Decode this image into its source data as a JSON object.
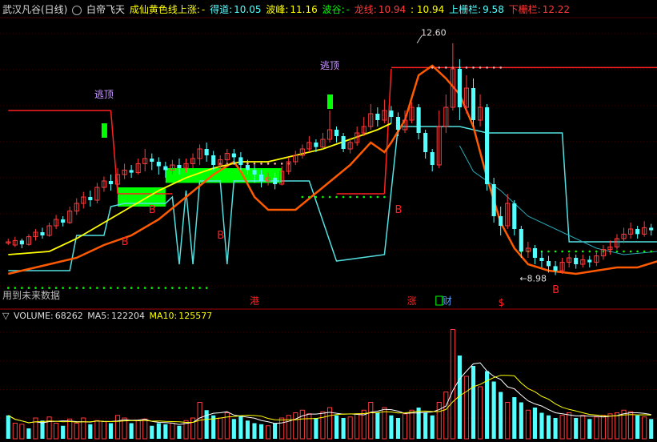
{
  "header": {
    "stock": "武汉凡谷(日线)",
    "indicator": "白帝飞天",
    "signal_label": "成仙黄色线上涨:",
    "signal_value": "-",
    "dezhi_label": "得道:",
    "dezhi_value": "10.05",
    "bofeng_label": "波峰:",
    "bofeng_value": "11.16",
    "bogu_label": "波谷:",
    "bogu_value": "-",
    "longxian_label": "龙线:",
    "longxian_value": "10.94",
    "sep_value": ": 10.94",
    "upper_label": "上栅栏:",
    "upper_value": "9.58",
    "lower_label": "下栅栏:",
    "lower_value": "12.22"
  },
  "note": "用到未来数据",
  "annotations": {
    "high_price": "12.60",
    "low_price": "8.98",
    "escape_top": "逃顶",
    "buy": "B",
    "events": [
      "港",
      "涨",
      "财",
      "$"
    ]
  },
  "volume_header": {
    "icon": "▽",
    "volume_label": "VOLUME:",
    "volume_value": "68262",
    "ma5_label": "MA5:",
    "ma5_value": "122204",
    "ma10_label": "MA10:",
    "ma10_value": "125577"
  },
  "colors": {
    "up": "#ff3b3b",
    "down": "#54ffff",
    "yellow": "#ffff00",
    "orange": "#ff5a00",
    "green": "#00ff00",
    "cyan_line": "#54e0e0",
    "red_line": "#ff2020",
    "purple": "#c89bff"
  },
  "chart_data": {
    "type": "candlestick",
    "price_range": [
      8.5,
      13.0
    ],
    "volume_max": 220000,
    "dezhi_resistance": 12.22,
    "candles": [
      [
        9.48,
        9.5,
        9.45,
        9.55,
        "up"
      ],
      [
        9.45,
        9.52,
        9.42,
        9.58,
        "up"
      ],
      [
        9.52,
        9.46,
        9.4,
        9.55,
        "dn"
      ],
      [
        9.46,
        9.58,
        9.44,
        9.62,
        "up"
      ],
      [
        9.58,
        9.65,
        9.52,
        9.7,
        "up"
      ],
      [
        9.65,
        9.6,
        9.55,
        9.72,
        "dn"
      ],
      [
        9.6,
        9.75,
        9.58,
        9.8,
        "up"
      ],
      [
        9.75,
        9.85,
        9.7,
        9.92,
        "up"
      ],
      [
        9.85,
        9.8,
        9.74,
        9.9,
        "dn"
      ],
      [
        9.8,
        9.98,
        9.78,
        10.05,
        "up"
      ],
      [
        9.98,
        10.1,
        9.92,
        10.18,
        "up"
      ],
      [
        10.1,
        10.2,
        10.02,
        10.28,
        "up"
      ],
      [
        10.2,
        10.15,
        10.05,
        10.3,
        "dn"
      ],
      [
        10.15,
        10.35,
        10.1,
        10.42,
        "up"
      ],
      [
        10.35,
        10.45,
        10.28,
        10.52,
        "up"
      ],
      [
        10.45,
        10.4,
        10.3,
        10.55,
        "dn"
      ],
      [
        10.4,
        10.55,
        10.35,
        10.65,
        "up"
      ],
      [
        10.55,
        10.62,
        10.48,
        10.72,
        "up"
      ],
      [
        10.62,
        10.58,
        10.5,
        10.7,
        "dn"
      ],
      [
        10.58,
        10.72,
        10.55,
        10.8,
        "up"
      ],
      [
        10.72,
        10.8,
        10.6,
        10.95,
        "up"
      ],
      [
        10.8,
        10.75,
        10.62,
        10.88,
        "dn"
      ],
      [
        10.75,
        10.68,
        10.55,
        10.82,
        "dn"
      ],
      [
        10.68,
        10.62,
        10.5,
        10.75,
        "dn"
      ],
      [
        10.62,
        10.7,
        10.55,
        10.78,
        "up"
      ],
      [
        10.7,
        10.65,
        10.55,
        10.8,
        "dn"
      ],
      [
        10.65,
        10.72,
        10.58,
        10.8,
        "up"
      ],
      [
        10.72,
        10.8,
        10.65,
        10.88,
        "up"
      ],
      [
        10.8,
        10.95,
        10.7,
        11.02,
        "up"
      ],
      [
        10.95,
        10.85,
        10.75,
        11.05,
        "dn"
      ],
      [
        10.85,
        10.7,
        10.62,
        10.92,
        "dn"
      ],
      [
        10.7,
        10.78,
        10.65,
        10.85,
        "up"
      ],
      [
        10.78,
        10.88,
        10.7,
        10.95,
        "up"
      ],
      [
        10.88,
        10.82,
        10.72,
        10.95,
        "dn"
      ],
      [
        10.82,
        10.7,
        10.62,
        10.9,
        "dn"
      ],
      [
        10.7,
        10.62,
        10.55,
        10.78,
        "dn"
      ],
      [
        10.62,
        10.55,
        10.42,
        10.7,
        "dn"
      ],
      [
        10.55,
        10.45,
        10.35,
        10.62,
        "dn"
      ],
      [
        10.45,
        10.5,
        10.38,
        10.58,
        "up"
      ],
      [
        10.5,
        10.4,
        10.32,
        10.58,
        "dn"
      ],
      [
        10.4,
        10.6,
        10.38,
        10.68,
        "up"
      ],
      [
        10.6,
        10.75,
        10.55,
        10.82,
        "up"
      ],
      [
        10.75,
        10.85,
        10.7,
        10.92,
        "up"
      ],
      [
        10.85,
        10.95,
        10.8,
        11.02,
        "up"
      ],
      [
        10.95,
        11.05,
        10.9,
        11.15,
        "up"
      ],
      [
        11.05,
        10.98,
        10.9,
        11.1,
        "dn"
      ],
      [
        10.98,
        11.1,
        10.95,
        11.2,
        "up"
      ],
      [
        11.1,
        11.25,
        11.05,
        11.55,
        "up"
      ],
      [
        11.25,
        11.15,
        11.05,
        11.3,
        "dn"
      ],
      [
        11.15,
        10.95,
        10.9,
        11.2,
        "dn"
      ],
      [
        10.95,
        11.05,
        10.88,
        11.12,
        "up"
      ],
      [
        11.05,
        11.2,
        11.0,
        11.3,
        "up"
      ],
      [
        11.2,
        11.3,
        11.15,
        11.45,
        "up"
      ],
      [
        11.3,
        11.5,
        11.25,
        11.65,
        "up"
      ],
      [
        11.5,
        11.4,
        11.3,
        11.6,
        "dn"
      ],
      [
        11.4,
        11.55,
        11.35,
        11.72,
        "up"
      ],
      [
        11.55,
        11.45,
        11.35,
        11.62,
        "dn"
      ],
      [
        11.45,
        11.25,
        11.15,
        11.52,
        "dn"
      ],
      [
        11.25,
        11.4,
        11.2,
        11.55,
        "up"
      ],
      [
        11.4,
        11.6,
        11.35,
        11.68,
        "up"
      ],
      [
        11.6,
        11.2,
        11.1,
        11.65,
        "dn"
      ],
      [
        11.2,
        10.9,
        10.8,
        11.25,
        "dn"
      ],
      [
        10.9,
        10.7,
        10.6,
        10.95,
        "dn"
      ],
      [
        10.7,
        11.3,
        10.65,
        11.55,
        "up"
      ],
      [
        11.3,
        11.6,
        11.2,
        11.8,
        "up"
      ],
      [
        11.6,
        12.2,
        11.55,
        12.6,
        "up"
      ],
      [
        12.2,
        11.6,
        11.4,
        12.35,
        "dn"
      ],
      [
        11.6,
        11.9,
        11.5,
        12.1,
        "up"
      ],
      [
        11.9,
        11.4,
        11.3,
        12.05,
        "dn"
      ],
      [
        11.4,
        11.6,
        11.3,
        11.8,
        "up"
      ],
      [
        11.6,
        10.4,
        10.3,
        11.65,
        "dn"
      ],
      [
        10.4,
        9.9,
        9.8,
        10.5,
        "dn"
      ],
      [
        9.9,
        9.75,
        9.6,
        10.05,
        "dn"
      ],
      [
        9.75,
        10.1,
        9.7,
        10.25,
        "up"
      ],
      [
        10.1,
        9.7,
        9.6,
        10.15,
        "dn"
      ],
      [
        9.7,
        9.35,
        9.25,
        9.75,
        "dn"
      ],
      [
        9.35,
        9.4,
        9.25,
        9.5,
        "up"
      ],
      [
        9.4,
        9.25,
        9.15,
        9.45,
        "dn"
      ],
      [
        9.25,
        9.2,
        9.1,
        9.35,
        "dn"
      ],
      [
        9.2,
        9.12,
        9.02,
        9.28,
        "dn"
      ],
      [
        9.12,
        9.05,
        8.98,
        9.2,
        "dn"
      ],
      [
        9.05,
        9.18,
        9.0,
        9.25,
        "up"
      ],
      [
        9.18,
        9.25,
        9.1,
        9.32,
        "up"
      ],
      [
        9.25,
        9.15,
        9.08,
        9.3,
        "dn"
      ],
      [
        9.15,
        9.22,
        9.1,
        9.3,
        "up"
      ],
      [
        9.22,
        9.18,
        9.1,
        9.28,
        "dn"
      ],
      [
        9.18,
        9.28,
        9.12,
        9.35,
        "up"
      ],
      [
        9.28,
        9.38,
        9.22,
        9.45,
        "up"
      ],
      [
        9.38,
        9.42,
        9.3,
        9.52,
        "up"
      ],
      [
        9.42,
        9.55,
        9.38,
        9.62,
        "up"
      ],
      [
        9.55,
        9.62,
        9.48,
        9.72,
        "up"
      ],
      [
        9.62,
        9.7,
        9.55,
        9.8,
        "up"
      ],
      [
        9.7,
        9.62,
        9.55,
        9.75,
        "dn"
      ],
      [
        9.62,
        9.72,
        9.58,
        9.82,
        "up"
      ],
      [
        9.72,
        9.68,
        9.6,
        9.78,
        "dn"
      ]
    ],
    "volumes": [
      [
        45,
        "dn"
      ],
      [
        30,
        "up"
      ],
      [
        28,
        "up"
      ],
      [
        20,
        "dn"
      ],
      [
        40,
        "up"
      ],
      [
        35,
        "dn"
      ],
      [
        42,
        "up"
      ],
      [
        30,
        "up"
      ],
      [
        25,
        "dn"
      ],
      [
        38,
        "up"
      ],
      [
        30,
        "up"
      ],
      [
        40,
        "up"
      ],
      [
        28,
        "dn"
      ],
      [
        35,
        "up"
      ],
      [
        33,
        "up"
      ],
      [
        30,
        "dn"
      ],
      [
        45,
        "up"
      ],
      [
        40,
        "up"
      ],
      [
        30,
        "dn"
      ],
      [
        35,
        "up"
      ],
      [
        38,
        "up"
      ],
      [
        25,
        "dn"
      ],
      [
        30,
        "dn"
      ],
      [
        28,
        "dn"
      ],
      [
        30,
        "up"
      ],
      [
        25,
        "dn"
      ],
      [
        35,
        "up"
      ],
      [
        40,
        "up"
      ],
      [
        70,
        "up"
      ],
      [
        55,
        "dn"
      ],
      [
        45,
        "dn"
      ],
      [
        40,
        "up"
      ],
      [
        50,
        "up"
      ],
      [
        38,
        "dn"
      ],
      [
        45,
        "dn"
      ],
      [
        35,
        "dn"
      ],
      [
        30,
        "dn"
      ],
      [
        28,
        "dn"
      ],
      [
        25,
        "up"
      ],
      [
        30,
        "dn"
      ],
      [
        40,
        "up"
      ],
      [
        45,
        "up"
      ],
      [
        50,
        "up"
      ],
      [
        55,
        "up"
      ],
      [
        48,
        "up"
      ],
      [
        40,
        "dn"
      ],
      [
        52,
        "up"
      ],
      [
        60,
        "up"
      ],
      [
        45,
        "dn"
      ],
      [
        40,
        "dn"
      ],
      [
        42,
        "up"
      ],
      [
        48,
        "up"
      ],
      [
        55,
        "up"
      ],
      [
        70,
        "up"
      ],
      [
        50,
        "dn"
      ],
      [
        60,
        "up"
      ],
      [
        45,
        "dn"
      ],
      [
        40,
        "dn"
      ],
      [
        48,
        "up"
      ],
      [
        55,
        "up"
      ],
      [
        60,
        "dn"
      ],
      [
        50,
        "dn"
      ],
      [
        45,
        "dn"
      ],
      [
        70,
        "up"
      ],
      [
        90,
        "up"
      ],
      [
        210,
        "up"
      ],
      [
        160,
        "dn"
      ],
      [
        120,
        "up"
      ],
      [
        140,
        "dn"
      ],
      [
        100,
        "up"
      ],
      [
        130,
        "dn"
      ],
      [
        110,
        "dn"
      ],
      [
        90,
        "dn"
      ],
      [
        70,
        "up"
      ],
      [
        80,
        "dn"
      ],
      [
        70,
        "dn"
      ],
      [
        55,
        "up"
      ],
      [
        60,
        "dn"
      ],
      [
        50,
        "dn"
      ],
      [
        45,
        "dn"
      ],
      [
        40,
        "dn"
      ],
      [
        45,
        "up"
      ],
      [
        50,
        "up"
      ],
      [
        40,
        "dn"
      ],
      [
        45,
        "up"
      ],
      [
        38,
        "dn"
      ],
      [
        42,
        "up"
      ],
      [
        45,
        "up"
      ],
      [
        48,
        "up"
      ],
      [
        50,
        "up"
      ],
      [
        55,
        "up"
      ],
      [
        52,
        "up"
      ],
      [
        45,
        "dn"
      ],
      [
        42,
        "up"
      ],
      [
        38,
        "dn"
      ]
    ]
  }
}
